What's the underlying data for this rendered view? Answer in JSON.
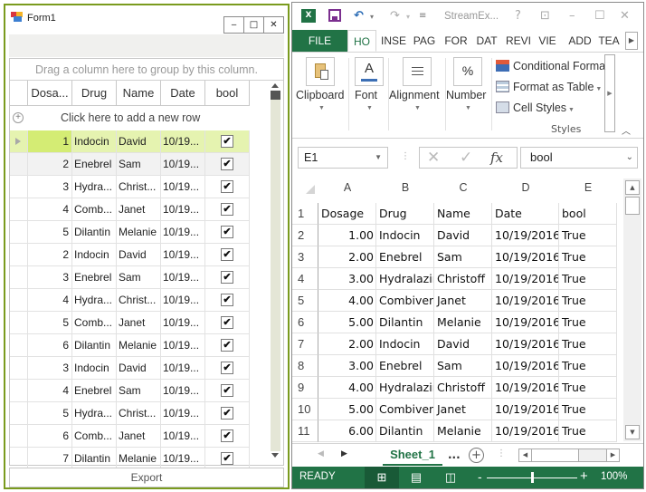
{
  "form1": {
    "title": "Form1",
    "controls": {
      "minimize": "‒",
      "maximize": "□",
      "close": "✕"
    },
    "group_panel_text": "Drag a column here to group by this column.",
    "columns": [
      "Dosa...",
      "Drug",
      "Name",
      "Date",
      "bool"
    ],
    "add_row_text": "Click here to add a new row",
    "rows": [
      {
        "dosage": "1",
        "drug": "Indocin",
        "name": "David",
        "date": "10/19...",
        "bool": true
      },
      {
        "dosage": "2",
        "drug": "Enebrel",
        "name": "Sam",
        "date": "10/19...",
        "bool": true
      },
      {
        "dosage": "3",
        "drug": "Hydra...",
        "name": "Christ...",
        "date": "10/19...",
        "bool": true
      },
      {
        "dosage": "4",
        "drug": "Comb...",
        "name": "Janet",
        "date": "10/19...",
        "bool": true
      },
      {
        "dosage": "5",
        "drug": "Dilantin",
        "name": "Melanie",
        "date": "10/19...",
        "bool": true
      },
      {
        "dosage": "2",
        "drug": "Indocin",
        "name": "David",
        "date": "10/19...",
        "bool": true
      },
      {
        "dosage": "3",
        "drug": "Enebrel",
        "name": "Sam",
        "date": "10/19...",
        "bool": true
      },
      {
        "dosage": "4",
        "drug": "Hydra...",
        "name": "Christ...",
        "date": "10/19...",
        "bool": true
      },
      {
        "dosage": "5",
        "drug": "Comb...",
        "name": "Janet",
        "date": "10/19...",
        "bool": true
      },
      {
        "dosage": "6",
        "drug": "Dilantin",
        "name": "Melanie",
        "date": "10/19...",
        "bool": true
      },
      {
        "dosage": "3",
        "drug": "Indocin",
        "name": "David",
        "date": "10/19...",
        "bool": true
      },
      {
        "dosage": "4",
        "drug": "Enebrel",
        "name": "Sam",
        "date": "10/19...",
        "bool": true
      },
      {
        "dosage": "5",
        "drug": "Hydra...",
        "name": "Christ...",
        "date": "10/19...",
        "bool": true
      },
      {
        "dosage": "6",
        "drug": "Comb...",
        "name": "Janet",
        "date": "10/19...",
        "bool": true
      },
      {
        "dosage": "7",
        "drug": "Dilantin",
        "name": "Melanie",
        "date": "10/19...",
        "bool": true
      }
    ],
    "selected_row_index": 0,
    "check_glyph": "✔",
    "export_label": "Export",
    "colors": {
      "border": "#7a9b1e",
      "selected_row": "#e5f3b0",
      "selected_cell": "#d4ec74"
    }
  },
  "excel": {
    "doc_title": "StreamEx...",
    "help": "?",
    "ribbon_tabs": [
      "FILE",
      "HO",
      "INSE",
      "PAG",
      "FOR",
      "DAT",
      "REVI",
      "VIE",
      "ADD",
      "TEA"
    ],
    "active_tab": "HO",
    "ribbon_groups": [
      {
        "label": "Clipboard",
        "icon": "clipboard-icon"
      },
      {
        "label": "Font",
        "icon": "font-icon"
      },
      {
        "label": "Alignment",
        "icon": "alignment-icon"
      },
      {
        "label": "Number",
        "icon": "percent-icon"
      }
    ],
    "styles": {
      "conditional": "Conditional Forma",
      "format_table": "Format as Table",
      "cell_styles": "Cell Styles",
      "label": "Styles"
    },
    "name_box": "E1",
    "formula_value": "bool",
    "col_headers": [
      "A",
      "B",
      "C",
      "D",
      "E"
    ],
    "rows": [
      {
        "n": "1",
        "a": "Dosage",
        "b": "Drug",
        "c": "Name",
        "d": "Date",
        "e": "bool"
      },
      {
        "n": "2",
        "a": "1.00",
        "b": "Indocin",
        "c": "David",
        "d": "10/19/2016",
        "e": "True"
      },
      {
        "n": "3",
        "a": "2.00",
        "b": "Enebrel",
        "c": "Sam",
        "d": "10/19/2016",
        "e": "True"
      },
      {
        "n": "4",
        "a": "3.00",
        "b": "Hydralazir",
        "c": "Christoff",
        "d": "10/19/2016",
        "e": "True"
      },
      {
        "n": "5",
        "a": "4.00",
        "b": "Combiven",
        "c": "Janet",
        "d": "10/19/2016",
        "e": "True"
      },
      {
        "n": "6",
        "a": "5.00",
        "b": "Dilantin",
        "c": "Melanie",
        "d": "10/19/2016",
        "e": "True"
      },
      {
        "n": "7",
        "a": "2.00",
        "b": "Indocin",
        "c": "David",
        "d": "10/19/2016",
        "e": "True"
      },
      {
        "n": "8",
        "a": "3.00",
        "b": "Enebrel",
        "c": "Sam",
        "d": "10/19/2016",
        "e": "True"
      },
      {
        "n": "9",
        "a": "4.00",
        "b": "Hydralazir",
        "c": "Christoff",
        "d": "10/19/2016",
        "e": "True"
      },
      {
        "n": "10",
        "a": "5.00",
        "b": "Combiven",
        "c": "Janet",
        "d": "10/19/2016",
        "e": "True"
      },
      {
        "n": "11",
        "a": "6.00",
        "b": "Dilantin",
        "c": "Melanie",
        "d": "10/19/2016",
        "e": "True"
      }
    ],
    "sheet_tab": "Sheet_1",
    "more_sheets": "...",
    "status": {
      "ready": "READY",
      "zoom": "100%",
      "zoom_percent": 100
    },
    "colors": {
      "brand": "#217346",
      "status_active": "#195a37"
    }
  }
}
